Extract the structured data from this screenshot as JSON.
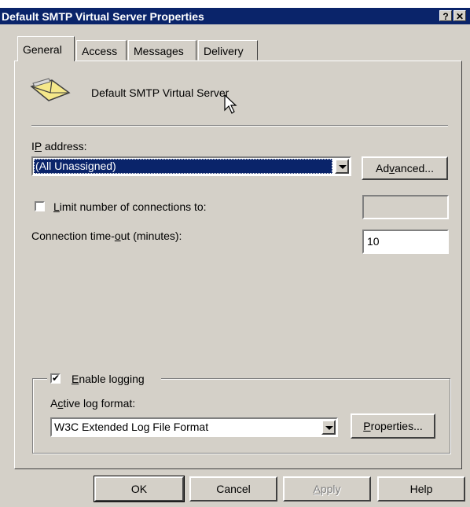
{
  "window": {
    "title": "Default SMTP Virtual Server Properties",
    "help_glyph": "?",
    "close_glyph": "✕"
  },
  "tabs": [
    {
      "label": "General",
      "active": true
    },
    {
      "label": "Access",
      "active": false
    },
    {
      "label": "Messages",
      "active": false
    },
    {
      "label": "Delivery",
      "active": false
    }
  ],
  "general": {
    "server_name": "Default SMTP Virtual Server",
    "ip_address": {
      "label_pre": "I",
      "label_accel": "P",
      "label_post": " address:",
      "value": "(All Unassigned)",
      "advanced_pre": "Ad",
      "advanced_accel": "v",
      "advanced_post": "anced..."
    },
    "limit_connections": {
      "checked": false,
      "label_accel": "L",
      "label_post": "imit number of connections to:",
      "value": ""
    },
    "timeout": {
      "label_pre": "Connection time-",
      "label_accel": "o",
      "label_post": "ut (minutes):",
      "value": "10"
    },
    "logging": {
      "checked": true,
      "check_glyph": "✔",
      "enable_accel": "E",
      "enable_post": "nable logging",
      "format_pre": "A",
      "format_accel": "c",
      "format_post": "tive log format:",
      "format_value": "W3C Extended Log File Format",
      "properties_accel": "P",
      "properties_post": "roperties..."
    }
  },
  "footer": {
    "ok": "OK",
    "cancel": "Cancel",
    "apply_accel": "A",
    "apply_post": "pply",
    "help": "Help"
  },
  "colors": {
    "title_bar": "#0a246a",
    "dialog_face": "#d4d0c8",
    "selection": "#0a246a"
  }
}
